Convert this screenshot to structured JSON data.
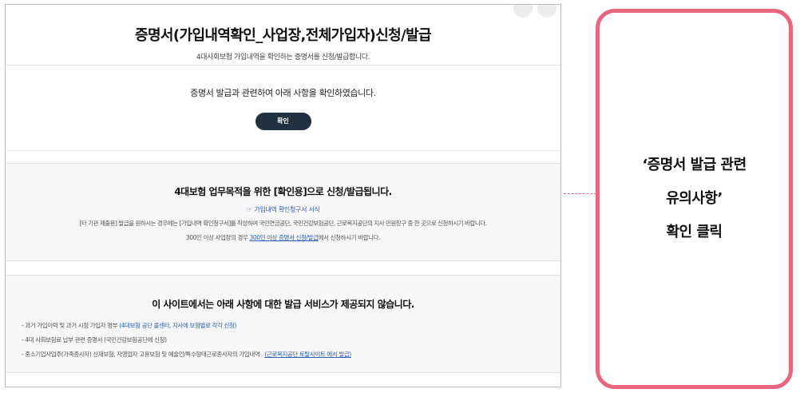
{
  "page": {
    "title": "증명서(가입내역확인_사업장,전체가입자)신청/발급",
    "subtitle": "4대사회보험 가입내역을 확인하는 증명서를 신청/발급합니다."
  },
  "confirm": {
    "text": "증명서 발급과 관련하여 아래 사항을 확인하였습니다.",
    "button_label": "확인"
  },
  "info": {
    "title": "4대보험 업무목적을 위한 [확인용]으로 신청/발급됩니다.",
    "link_icon": "☞",
    "link_label": "가입내역 확인청구서 서식",
    "description": "[타 기관 제출용] 발급을 원하시는 경우에는 [가입내역 확인청구서]를 작성하여 국민연금공단, 국민건강보험공단, 근로복지공단의 지사 민원창구 중 한 곳으로 신청하시기 바랍니다.",
    "desc2_prefix": "300인 이상 사업장의 경우",
    "desc2_link": "300인 이상 증명서 신청/발급",
    "desc2_suffix": "에서 신청하시기 바랍니다."
  },
  "notice": {
    "title": "이 사이트에서는 아래 사항에 대한 발급 서비스가 제공되지 않습니다.",
    "item1_text": "- 과거 가입이력 및 과거 시점 가입자 명부",
    "item1_hl": "(4대보험 공단 콜센터, 지사에 보험별로 각각 신청)",
    "item2_text": "- 4대 사회보험료 납부 관련 증명서 (국민건강보험공단에 신청)",
    "item3_text": "- 중소기업사업주(가족종사자) 산재보험, 자영업자 고용보험 및 예술인/특수형태근로종사자의 가입내역",
    "item3_link": "(근로복지공단 토탈사이트 에서 발급)"
  },
  "callout": {
    "line1": "‘증명서 발급 관련",
    "line2": "유의사항’",
    "line3": "확인 클릭"
  },
  "colors": {
    "accent_pink": "#e8677f",
    "button_dark": "#22303f",
    "link_blue": "#2b5fb8"
  }
}
